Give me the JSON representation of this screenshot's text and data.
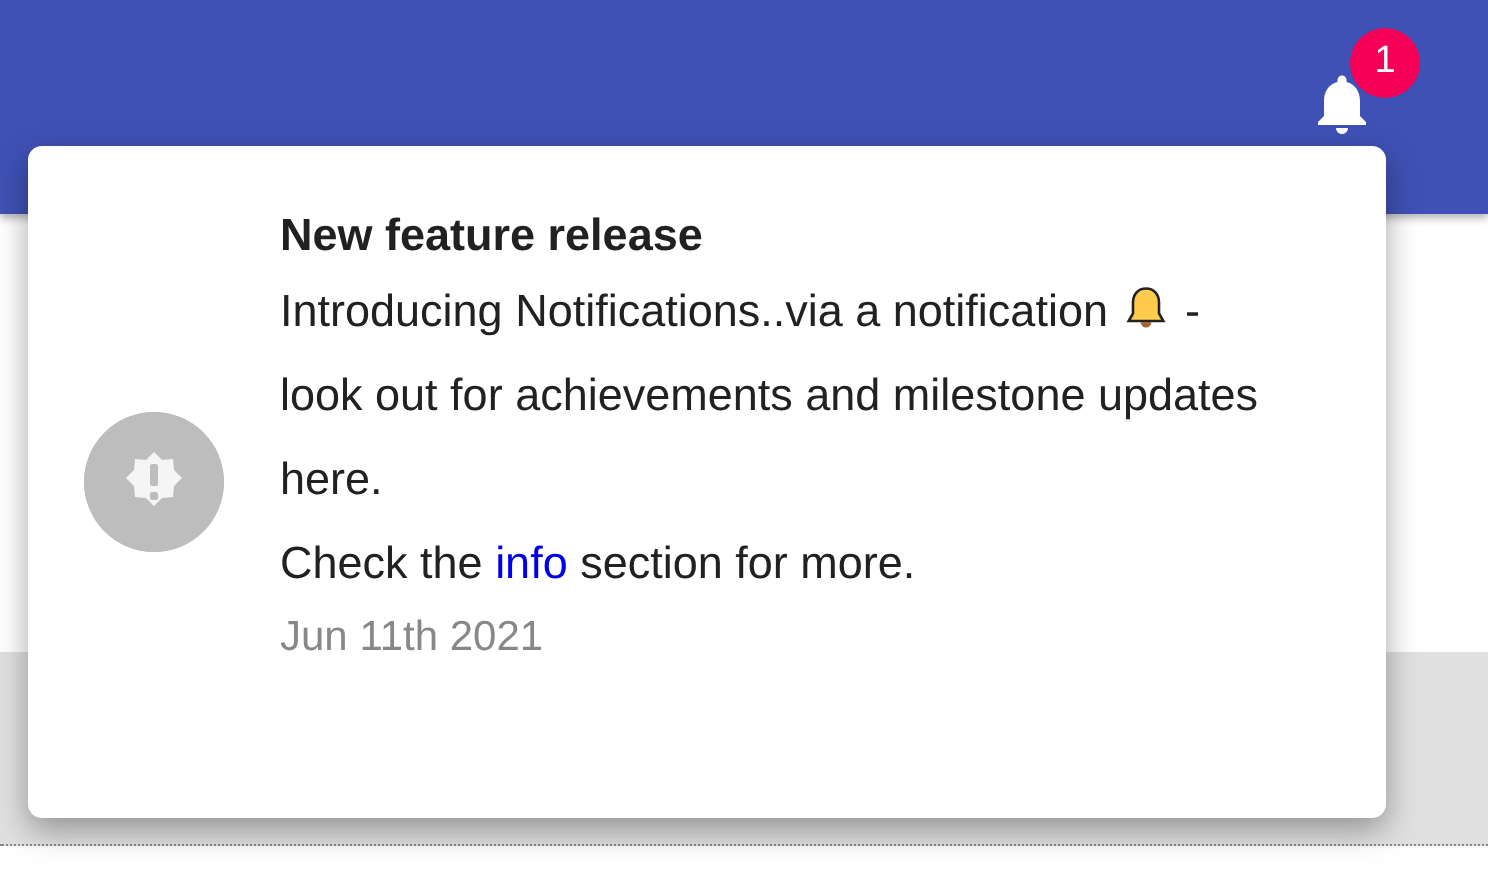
{
  "header": {
    "notification_count": "1"
  },
  "notification": {
    "title": "New feature release",
    "message_start": "Introducing Notifications..via a notification",
    "message_end": "- look out for achievements and milestone updates here.",
    "footer_start": "Check the",
    "footer_link": "info",
    "footer_end": "section for more.",
    "date": "Jun 11th 2021"
  }
}
